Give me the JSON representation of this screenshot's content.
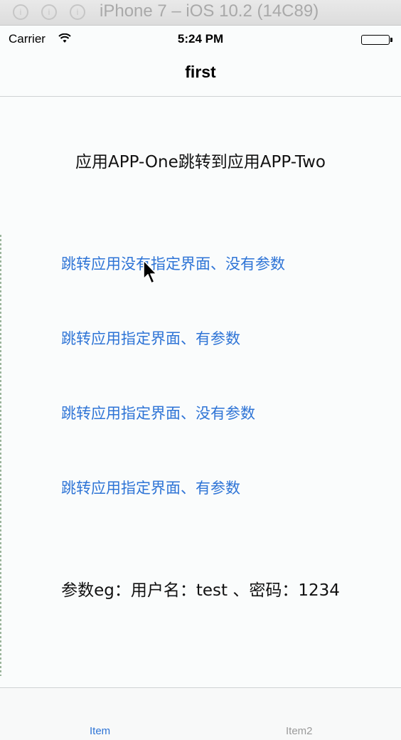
{
  "window": {
    "title": "iPhone 7 – iOS 10.2 (14C89)"
  },
  "status_bar": {
    "carrier": "Carrier",
    "time": "5:24 PM"
  },
  "nav": {
    "title": "first"
  },
  "main": {
    "heading": "应用APP-One跳转到应用APP-Two",
    "buttons": [
      {
        "label": "跳转应用没有指定界面、没有参数"
      },
      {
        "label": "跳转应用指定界面、有参数"
      },
      {
        "label": "跳转应用指定界面、没有参数"
      },
      {
        "label": "跳转应用指定界面、有参数"
      }
    ],
    "params_text": "参数eg：用户名：test 、密码：1234"
  },
  "tab_bar": {
    "items": [
      {
        "label": "Item",
        "selected": true
      },
      {
        "label": "Item2",
        "selected": false
      }
    ]
  },
  "colors": {
    "accent": "#2e74d6",
    "background": "#fafcfc",
    "inactive_tab": "#9a9a9a"
  }
}
